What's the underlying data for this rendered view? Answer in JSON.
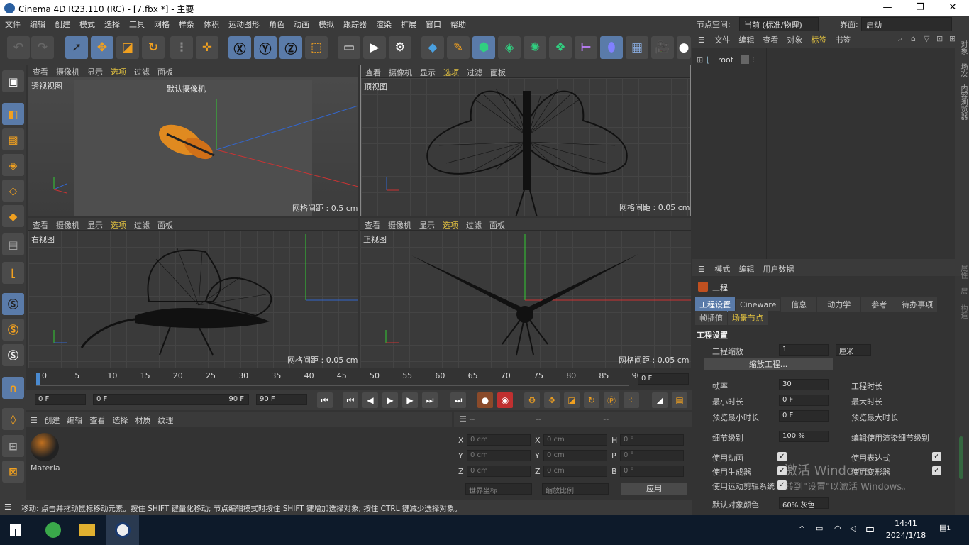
{
  "window": {
    "title": "Cinema 4D R23.110 (RC) - [7.fbx *] - 主要",
    "min": "—",
    "max": "❐",
    "close": "✕"
  },
  "menu": [
    "文件",
    "编辑",
    "创建",
    "模式",
    "选择",
    "工具",
    "网格",
    "样条",
    "体积",
    "运动图形",
    "角色",
    "动画",
    "模拟",
    "跟踪器",
    "渲染",
    "扩展",
    "窗口",
    "帮助"
  ],
  "right_top": {
    "node_space_label": "节点空间:",
    "node_space_value": "当前 (标准/物理)",
    "interface_label": "界面:",
    "interface_value": "启动"
  },
  "viewport_menu": [
    "查看",
    "摄像机",
    "显示",
    "选项",
    "过滤",
    "面板"
  ],
  "viewports": {
    "persp": {
      "label": "透视视图",
      "camera": "默认摄像机",
      "grid": "网格间距 : 0.5 cm"
    },
    "top": {
      "label": "顶视图",
      "grid": "网格间距 : 0.05 cm"
    },
    "right": {
      "label": "右视图",
      "grid": "网格间距 : 0.05 cm"
    },
    "front": {
      "label": "正视图",
      "grid": "网格间距 : 0.05 cm"
    }
  },
  "timeline": {
    "ticks": [
      "0",
      "5",
      "10",
      "15",
      "20",
      "25",
      "30",
      "35",
      "40",
      "45",
      "50",
      "55",
      "60",
      "65",
      "70",
      "75",
      "80",
      "85",
      "90"
    ],
    "end_frame": "0 F"
  },
  "playbar": {
    "start": "0 F",
    "range_start": "0 F",
    "range_end": "90 F",
    "end": "90 F"
  },
  "materials": {
    "menu": [
      "创建",
      "编辑",
      "查看",
      "选择",
      "材质",
      "纹理"
    ],
    "item": "Materia"
  },
  "coords": {
    "headers": [
      "--",
      "--",
      "--"
    ],
    "rows": [
      {
        "a": "X",
        "av": "0 cm",
        "b": "X",
        "bv": "0 cm",
        "c": "H",
        "cv": "0 °"
      },
      {
        "a": "Y",
        "av": "0 cm",
        "b": "Y",
        "bv": "0 cm",
        "c": "P",
        "cv": "0 °"
      },
      {
        "a": "Z",
        "av": "0 cm",
        "b": "Z",
        "bv": "0 cm",
        "c": "B",
        "cv": "0 °"
      }
    ],
    "world": "世界坐标",
    "scale": "缩放比例",
    "apply": "应用"
  },
  "status": "移动: 点击并拖动鼠标移动元素。按住 SHIFT 键量化移动; 节点编辑模式时按住 SHIFT 键增加选择对象; 按住 CTRL 键减少选择对象。",
  "objmgr": {
    "menu": [
      "文件",
      "编辑",
      "查看",
      "对象",
      "标签",
      "书签"
    ],
    "root": "root"
  },
  "attrmgr": {
    "menu": [
      "模式",
      "编辑",
      "用户数据"
    ],
    "title": "工程",
    "tabs": [
      "工程设置",
      "Cineware",
      "信息",
      "动力学",
      "参考",
      "待办事项"
    ],
    "tabs2": [
      "帧插值",
      "场景节点"
    ],
    "section": "工程设置",
    "scale_label": "工程缩放",
    "scale_value": "1",
    "scale_unit": "厘米",
    "scale_btn": "缩放工程...",
    "fps_label": "帧率",
    "fps_value": "30",
    "time_label": "工程时长",
    "min_label": "最小时长",
    "min_value": "0 F",
    "max_label": "最大时长",
    "pmin_label": "预览最小时长",
    "pmin_value": "0 F",
    "pmax_label": "预览最大时长",
    "lod_label": "细节级别",
    "lod_value": "100 %",
    "lod_render": "编辑使用渲染细节级别",
    "anim": "使用动画",
    "expr": "使用表达式",
    "gen": "使用生成器",
    "deform": "使用变形器",
    "motion": "使用运动剪辑系统",
    "default_color": "默认对象颜色",
    "default_color_value": "60% 灰色",
    "activate": "激活 Windows",
    "activate_sub": "转到\"设置\"以激活 Windows。"
  },
  "side_tabs_top": [
    "对象",
    "场次",
    "内容浏览器"
  ],
  "side_tabs_bottom": [
    "属性",
    "层",
    "构造"
  ],
  "taskbar": {
    "time": "14:41",
    "date": "2024/1/18",
    "ime": "中",
    "notify": "1"
  }
}
